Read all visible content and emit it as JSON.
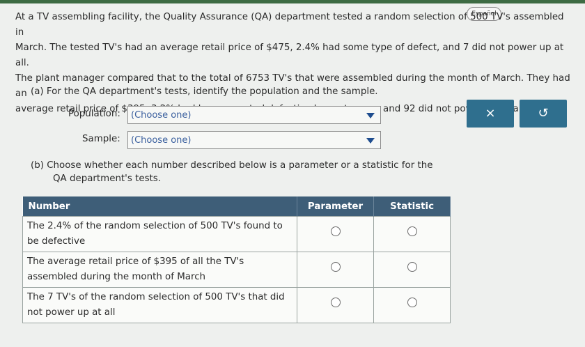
{
  "colors": {
    "header_bg": "#3e5e78",
    "button_bg": "#2f6f8e",
    "top_bar": "#3d6b43"
  },
  "language_button": "Español",
  "problem_text": [
    "At a TV assembling facility, the Quality Assurance (QA) department tested a random selection of 500 TV's assembled in",
    "March. The tested TV's had an average retail price of $475, 2.4% had some type of defect, and 7 did not power up at all.",
    "The plant manager compared that to the total of 6753 TV's that were assembled during the month of March. They had an",
    "average retail price of $395, 3.2% had been reported defective by customers, and 92 did not power up at all."
  ],
  "part_a": {
    "prompt": "(a)  For the QA department's tests, identify the population and the sample.",
    "population_label": "Population:",
    "population_value": "(Choose one)",
    "sample_label": "Sample:",
    "sample_value": "(Choose one)"
  },
  "buttons": {
    "clear_icon": "×",
    "undo_icon": "↺"
  },
  "part_b": {
    "prompt_line1": "(b)  Choose whether each number described below is a parameter or a statistic for the",
    "prompt_line2": "QA department's tests."
  },
  "table": {
    "headers": [
      "Number",
      "Parameter",
      "Statistic"
    ],
    "rows": [
      "The 2.4% of the random selection of 500 TV's found to be defective",
      "The average retail price of $395 of all the TV's assembled during the month of March",
      "The 7 TV's of the random selection of 500 TV's that did not power up at all"
    ]
  }
}
